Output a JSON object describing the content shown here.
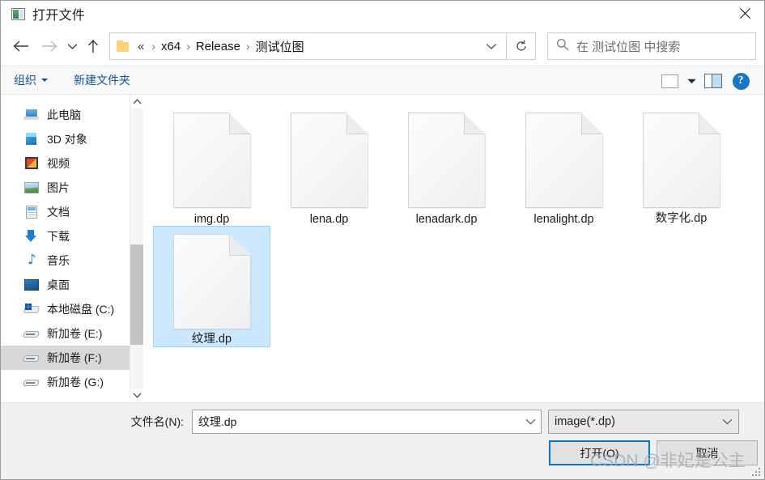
{
  "window": {
    "title": "打开文件",
    "title_icon": "image-file-icon",
    "close_label": "✕"
  },
  "nav": {
    "back_icon": "arrow-left-icon",
    "forward_icon": "arrow-right-icon",
    "history_icon": "chevron-down-icon",
    "up_icon": "arrow-up-icon",
    "folder_icon": "folder-icon",
    "ellipsis": "«",
    "breadcrumbs": [
      "x64",
      "Release",
      "测试位图"
    ],
    "separator": "›",
    "dropdown_icon": "chevron-down-icon",
    "refresh_icon": "refresh-icon"
  },
  "search": {
    "icon": "search-icon",
    "placeholder": "在 测试位图 中搜索"
  },
  "toolbar": {
    "organize_label": "组织",
    "new_folder_label": "新建文件夹",
    "view_icon": "thumbnail-view-icon",
    "view_dropdown_icon": "caret-down-icon",
    "preview_pane_icon": "preview-pane-icon",
    "help_icon": "help-icon",
    "help_label": "?"
  },
  "sidebar": {
    "items": [
      {
        "label": "此电脑",
        "icon": "computer-icon",
        "icon_class": "ic-pc",
        "selected": false
      },
      {
        "label": "3D 对象",
        "icon": "3d-objects-icon",
        "icon_class": "ic-3d",
        "selected": false
      },
      {
        "label": "视频",
        "icon": "videos-icon",
        "icon_class": "ic-vid",
        "selected": false
      },
      {
        "label": "图片",
        "icon": "pictures-icon",
        "icon_class": "ic-pic",
        "selected": false
      },
      {
        "label": "文档",
        "icon": "documents-icon",
        "icon_class": "ic-doc",
        "selected": false
      },
      {
        "label": "下载",
        "icon": "downloads-icon",
        "icon_class": "ic-dl",
        "selected": false
      },
      {
        "label": "音乐",
        "icon": "music-icon",
        "icon_class": "ic-mus",
        "selected": false
      },
      {
        "label": "桌面",
        "icon": "desktop-icon",
        "icon_class": "ic-desk",
        "selected": false
      },
      {
        "label": "本地磁盘 (C:)",
        "icon": "local-disk-icon",
        "icon_class": "ic-hdd",
        "selected": false
      },
      {
        "label": "新加卷 (E:)",
        "icon": "volume-drive-icon",
        "icon_class": "ic-vol",
        "selected": false
      },
      {
        "label": "新加卷 (F:)",
        "icon": "volume-drive-icon",
        "icon_class": "ic-vol",
        "selected": true
      },
      {
        "label": "新加卷 (G:)",
        "icon": "volume-drive-icon",
        "icon_class": "ic-vol",
        "selected": false
      }
    ],
    "scroll_up_icon": "chevron-up-icon",
    "scroll_down_icon": "chevron-down-icon"
  },
  "files": [
    {
      "name": "img.dp",
      "icon": "blank-document-icon",
      "selected": false
    },
    {
      "name": "lena.dp",
      "icon": "blank-document-icon",
      "selected": false
    },
    {
      "name": "lenadark.dp",
      "icon": "blank-document-icon",
      "selected": false
    },
    {
      "name": "lenalight.dp",
      "icon": "blank-document-icon",
      "selected": false
    },
    {
      "name": "数字化.dp",
      "icon": "blank-document-icon",
      "selected": false
    },
    {
      "name": "纹理.dp",
      "icon": "blank-document-icon",
      "selected": true
    }
  ],
  "footer": {
    "filename_label": "文件名(N):",
    "filename_value": "纹理.dp",
    "filename_dropdown_icon": "chevron-down-icon",
    "filter_value": "image(*.dp)",
    "filter_dropdown_icon": "chevron-down-icon",
    "open_label": "打开(O)",
    "cancel_label": "取消"
  },
  "watermark": {
    "text": "CSDN @非妃是公主"
  },
  "colors": {
    "accent": "#0078d7",
    "selection_fill": "#cce8ff",
    "selection_border": "#99d1ff",
    "sidebar_selection": "#d8d8d8",
    "toolbar_link": "#15518f",
    "footer_bg": "#f0f0f0",
    "help_blue": "#1479c8"
  }
}
